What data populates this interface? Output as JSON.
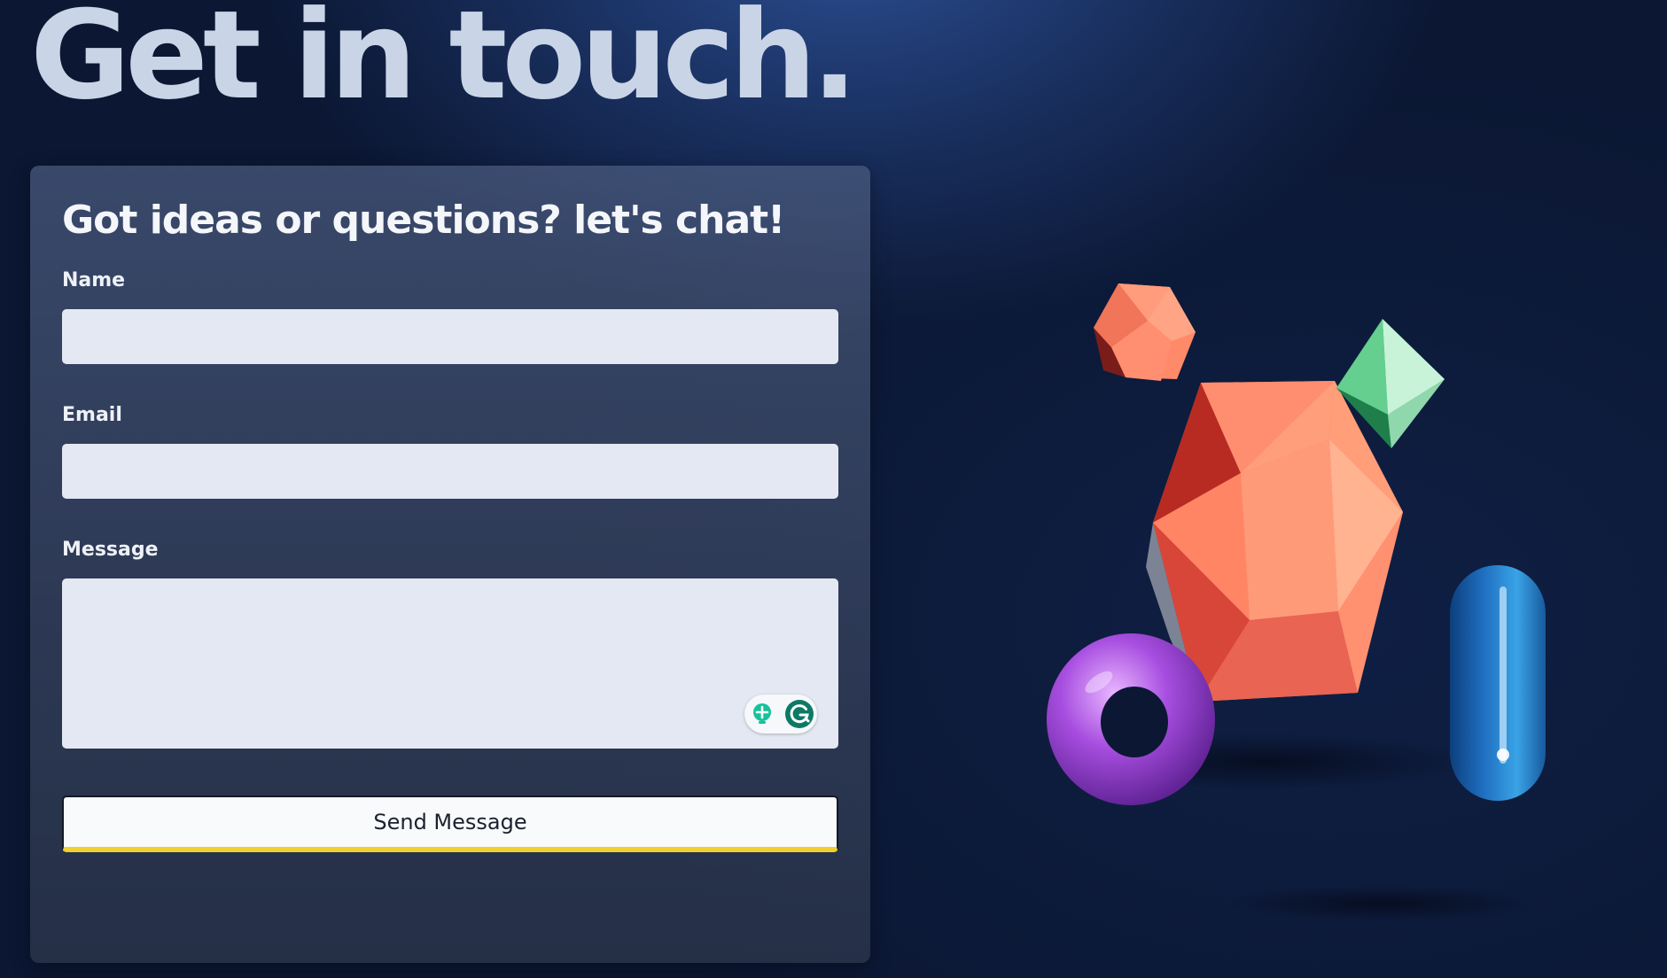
{
  "page": {
    "title": "Get in touch."
  },
  "form": {
    "heading": "Got ideas or questions? let's chat!",
    "name_label": "Name",
    "name_value": "",
    "email_label": "Email",
    "email_value": "",
    "message_label": "Message",
    "message_value": "",
    "submit_label": "Send Message"
  },
  "icons": {
    "grammarly_suggestion": "lightbulb-icon",
    "grammarly_logo": "grammarly-g-icon"
  },
  "colors": {
    "heading": "#c9d4e6",
    "input_bg": "#e3e8f2",
    "button_accent": "#f1cf2f",
    "grammarly_green": "#15c39a"
  }
}
